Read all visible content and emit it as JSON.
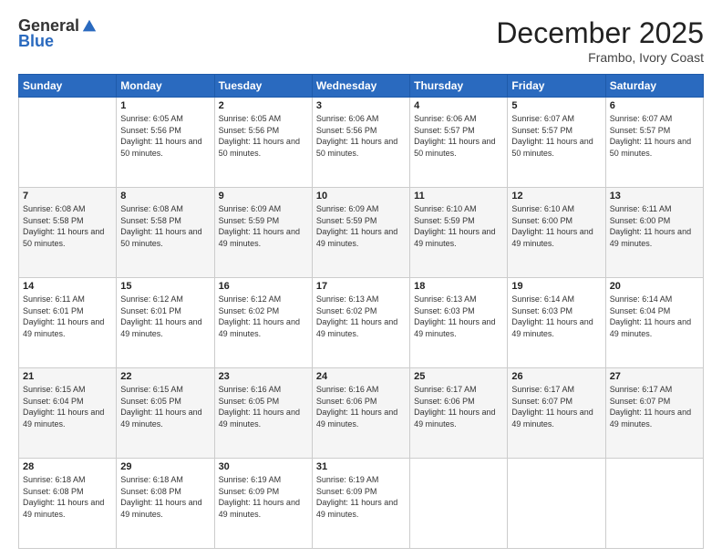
{
  "header": {
    "logo": {
      "general": "General",
      "blue": "Blue"
    },
    "title": "December 2025",
    "location": "Frambo, Ivory Coast"
  },
  "weekdays": [
    "Sunday",
    "Monday",
    "Tuesday",
    "Wednesday",
    "Thursday",
    "Friday",
    "Saturday"
  ],
  "weeks": [
    [
      {
        "day": "",
        "info": ""
      },
      {
        "day": "1",
        "info": "Sunrise: 6:05 AM\nSunset: 5:56 PM\nDaylight: 11 hours and 50 minutes."
      },
      {
        "day": "2",
        "info": "Sunrise: 6:05 AM\nSunset: 5:56 PM\nDaylight: 11 hours and 50 minutes."
      },
      {
        "day": "3",
        "info": "Sunrise: 6:06 AM\nSunset: 5:56 PM\nDaylight: 11 hours and 50 minutes."
      },
      {
        "day": "4",
        "info": "Sunrise: 6:06 AM\nSunset: 5:57 PM\nDaylight: 11 hours and 50 minutes."
      },
      {
        "day": "5",
        "info": "Sunrise: 6:07 AM\nSunset: 5:57 PM\nDaylight: 11 hours and 50 minutes."
      },
      {
        "day": "6",
        "info": "Sunrise: 6:07 AM\nSunset: 5:57 PM\nDaylight: 11 hours and 50 minutes."
      }
    ],
    [
      {
        "day": "7",
        "info": "Sunrise: 6:08 AM\nSunset: 5:58 PM\nDaylight: 11 hours and 50 minutes."
      },
      {
        "day": "8",
        "info": "Sunrise: 6:08 AM\nSunset: 5:58 PM\nDaylight: 11 hours and 50 minutes."
      },
      {
        "day": "9",
        "info": "Sunrise: 6:09 AM\nSunset: 5:59 PM\nDaylight: 11 hours and 49 minutes."
      },
      {
        "day": "10",
        "info": "Sunrise: 6:09 AM\nSunset: 5:59 PM\nDaylight: 11 hours and 49 minutes."
      },
      {
        "day": "11",
        "info": "Sunrise: 6:10 AM\nSunset: 5:59 PM\nDaylight: 11 hours and 49 minutes."
      },
      {
        "day": "12",
        "info": "Sunrise: 6:10 AM\nSunset: 6:00 PM\nDaylight: 11 hours and 49 minutes."
      },
      {
        "day": "13",
        "info": "Sunrise: 6:11 AM\nSunset: 6:00 PM\nDaylight: 11 hours and 49 minutes."
      }
    ],
    [
      {
        "day": "14",
        "info": "Sunrise: 6:11 AM\nSunset: 6:01 PM\nDaylight: 11 hours and 49 minutes."
      },
      {
        "day": "15",
        "info": "Sunrise: 6:12 AM\nSunset: 6:01 PM\nDaylight: 11 hours and 49 minutes."
      },
      {
        "day": "16",
        "info": "Sunrise: 6:12 AM\nSunset: 6:02 PM\nDaylight: 11 hours and 49 minutes."
      },
      {
        "day": "17",
        "info": "Sunrise: 6:13 AM\nSunset: 6:02 PM\nDaylight: 11 hours and 49 minutes."
      },
      {
        "day": "18",
        "info": "Sunrise: 6:13 AM\nSunset: 6:03 PM\nDaylight: 11 hours and 49 minutes."
      },
      {
        "day": "19",
        "info": "Sunrise: 6:14 AM\nSunset: 6:03 PM\nDaylight: 11 hours and 49 minutes."
      },
      {
        "day": "20",
        "info": "Sunrise: 6:14 AM\nSunset: 6:04 PM\nDaylight: 11 hours and 49 minutes."
      }
    ],
    [
      {
        "day": "21",
        "info": "Sunrise: 6:15 AM\nSunset: 6:04 PM\nDaylight: 11 hours and 49 minutes."
      },
      {
        "day": "22",
        "info": "Sunrise: 6:15 AM\nSunset: 6:05 PM\nDaylight: 11 hours and 49 minutes."
      },
      {
        "day": "23",
        "info": "Sunrise: 6:16 AM\nSunset: 6:05 PM\nDaylight: 11 hours and 49 minutes."
      },
      {
        "day": "24",
        "info": "Sunrise: 6:16 AM\nSunset: 6:06 PM\nDaylight: 11 hours and 49 minutes."
      },
      {
        "day": "25",
        "info": "Sunrise: 6:17 AM\nSunset: 6:06 PM\nDaylight: 11 hours and 49 minutes."
      },
      {
        "day": "26",
        "info": "Sunrise: 6:17 AM\nSunset: 6:07 PM\nDaylight: 11 hours and 49 minutes."
      },
      {
        "day": "27",
        "info": "Sunrise: 6:17 AM\nSunset: 6:07 PM\nDaylight: 11 hours and 49 minutes."
      }
    ],
    [
      {
        "day": "28",
        "info": "Sunrise: 6:18 AM\nSunset: 6:08 PM\nDaylight: 11 hours and 49 minutes."
      },
      {
        "day": "29",
        "info": "Sunrise: 6:18 AM\nSunset: 6:08 PM\nDaylight: 11 hours and 49 minutes."
      },
      {
        "day": "30",
        "info": "Sunrise: 6:19 AM\nSunset: 6:09 PM\nDaylight: 11 hours and 49 minutes."
      },
      {
        "day": "31",
        "info": "Sunrise: 6:19 AM\nSunset: 6:09 PM\nDaylight: 11 hours and 49 minutes."
      },
      {
        "day": "",
        "info": ""
      },
      {
        "day": "",
        "info": ""
      },
      {
        "day": "",
        "info": ""
      }
    ]
  ]
}
